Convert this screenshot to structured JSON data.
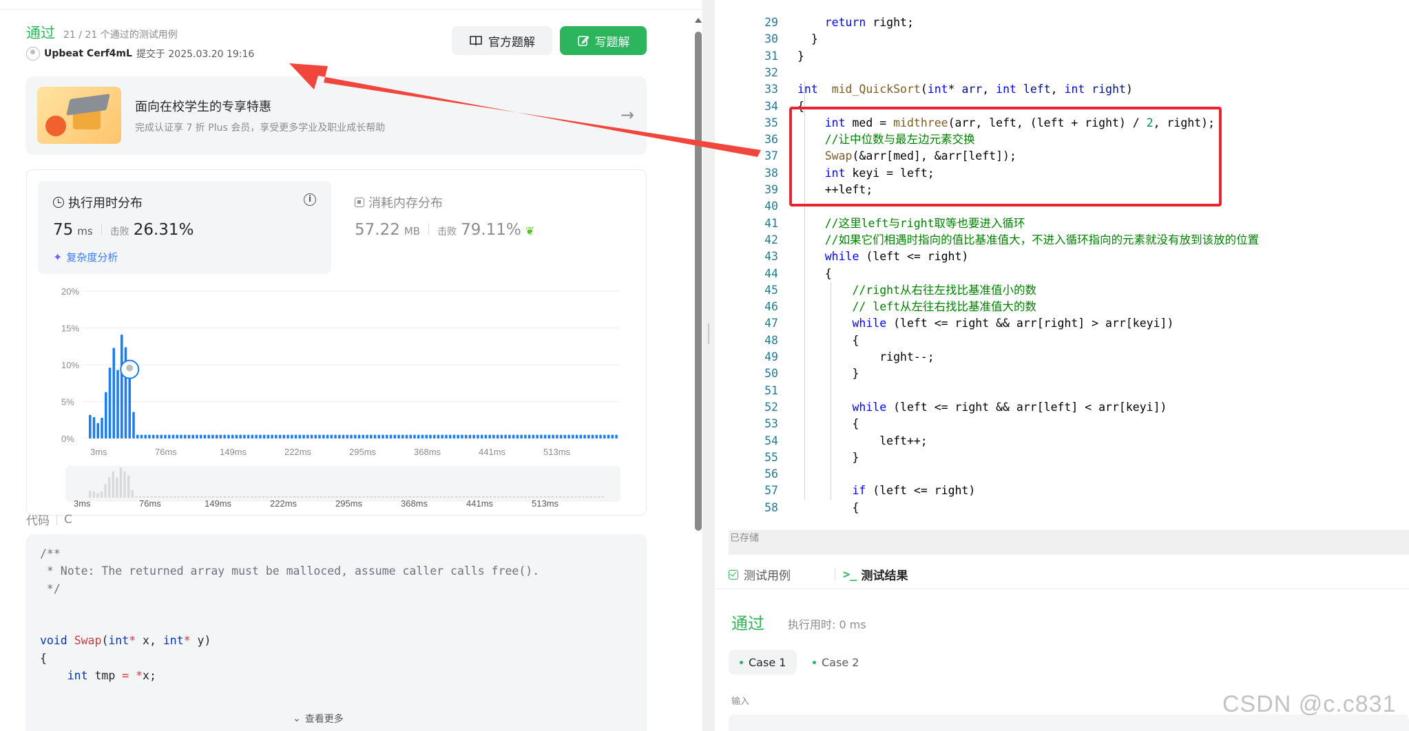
{
  "submission": {
    "status": "通过",
    "testcases": "21 / 21 个通过的测试用例",
    "user": "Upbeat Cerf4mL",
    "submitted_at": "提交于 2025.03.20 19:16"
  },
  "buttons": {
    "official_solution": "官方题解",
    "write_solution": "写题解"
  },
  "promo": {
    "title": "面向在校学生的专享特惠",
    "desc": "完成认证享 7 折 Plus 会员，享受更多学业及职业成长帮助"
  },
  "runtime": {
    "title": "执行用时分布",
    "value": "75",
    "unit": "ms",
    "beat_label": "击败",
    "beat": "26.31%",
    "complexity_link": "复杂度分析"
  },
  "memory": {
    "title": "消耗内存分布",
    "value": "57.22",
    "unit": "MB",
    "beat_label": "击败",
    "beat": "79.11%"
  },
  "chart_data": {
    "type": "bar",
    "ylabel_ticks": [
      "0%",
      "5%",
      "10%",
      "15%",
      "20%"
    ],
    "ylim": [
      0,
      20
    ],
    "x_tick_labels": [
      "3ms",
      "76ms",
      "149ms",
      "222ms",
      "295ms",
      "368ms",
      "441ms",
      "513ms"
    ],
    "x_start": 3,
    "x_step": 4,
    "values": [
      3.2,
      2.9,
      2.1,
      2.8,
      6.3,
      9.6,
      12.3,
      9.3,
      14.1,
      12.4,
      10.5,
      3.6,
      0.5,
      0.5,
      0.5,
      0.5,
      0.5,
      0.5,
      0.5,
      0.5,
      0.5,
      0.5,
      0.5,
      0.5,
      0.5,
      0.5,
      0.5,
      0.5,
      0.5,
      0.5,
      0.5,
      0.5,
      0.5,
      0.5,
      0.5,
      0.5,
      0.5,
      0.5,
      0.5,
      0.5,
      0.5,
      0.5,
      0.5,
      0.5,
      0.5,
      0.5,
      0.5,
      0.5,
      0.5,
      0.5,
      0.5,
      0.5,
      0.5,
      0.5,
      0.5,
      0.5,
      0.5,
      0.5,
      0.5,
      0.5,
      0.5,
      0.5,
      0.5,
      0.5,
      0.5,
      0.5,
      0.5,
      0.5,
      0.5,
      0.5,
      0.5,
      0.5,
      0.5,
      0.5,
      0.5,
      0.5,
      0.5,
      0.5,
      0.5,
      0.5,
      0.5,
      0.5,
      0.5,
      0.5,
      0.5,
      0.5,
      0.5,
      0.5,
      0.5,
      0.5,
      0.5,
      0.5,
      0.5,
      0.5,
      0.5,
      0.5,
      0.5,
      0.5,
      0.5,
      0.5,
      0.5,
      0.5,
      0.5,
      0.5,
      0.5,
      0.5,
      0.5,
      0.5,
      0.5,
      0.5,
      0.5,
      0.5,
      0.5,
      0.5,
      0.5,
      0.5,
      0.5,
      0.5,
      0.5,
      0.5,
      0.5,
      0.5,
      0.5,
      0.5,
      0.5,
      0.5,
      0.5,
      0.5,
      0.5,
      0.5,
      0.5,
      0.5,
      0.5,
      0.5
    ],
    "marker_index": 10,
    "bar_color": "#1a7ef0",
    "grid": true
  },
  "code_section": {
    "label": "代码",
    "lang": "C",
    "view_more": "查看更多"
  },
  "editor": {
    "saved": "已存储",
    "lines": [
      {
        "n": "29",
        "html": "    <span class='e-kw'>return</span> right;"
      },
      {
        "n": "30",
        "html": "  }"
      },
      {
        "n": "31",
        "html": "}"
      },
      {
        "n": "32",
        "html": ""
      },
      {
        "n": "33",
        "html": "<span class='e-kw'>int</span>  <span class='e-fn'>mid_QuickSort</span>(<span class='e-kw'>int</span>* <span class='e-var'>arr</span>, <span class='e-kw'>int</span> <span class='e-var'>left</span>, <span class='e-kw'>int</span> <span class='e-var'>right</span>)"
      },
      {
        "n": "34",
        "html": "{"
      },
      {
        "n": "35",
        "html": "    <span class='e-kw'>int</span> med = <span class='e-fn'>midthree</span>(arr, left, (left + right) / <span class='e-num'>2</span>, right);"
      },
      {
        "n": "36",
        "html": "    <span class='e-com'>//让中位数与最左边元素交换</span>"
      },
      {
        "n": "37",
        "html": "    <span class='e-fn'>Swap</span>(&amp;arr[med], &amp;arr[left]);"
      },
      {
        "n": "38",
        "html": "    <span class='e-kw'>int</span> keyi = left;"
      },
      {
        "n": "39",
        "html": "    ++left;"
      },
      {
        "n": "40",
        "html": ""
      },
      {
        "n": "41",
        "html": "    <span class='e-com'>//这里left与right取等也要进入循环</span>"
      },
      {
        "n": "42",
        "html": "    <span class='e-com'>//如果它们相遇时指向的值比基准值大，不进入循环指向的元素就没有放到该放的位置</span>"
      },
      {
        "n": "43",
        "html": "    <span class='e-kw'>while</span> (left &lt;= right)"
      },
      {
        "n": "44",
        "html": "    {"
      },
      {
        "n": "45",
        "html": "        <span class='e-com'>//right从右往左找比基准值小的数</span>"
      },
      {
        "n": "46",
        "html": "        <span class='e-com'>// left从左往右找比基准值大的数</span>"
      },
      {
        "n": "47",
        "html": "        <span class='e-kw'>while</span> (left &lt;= right &amp;&amp; arr[right] &gt; arr[keyi])"
      },
      {
        "n": "48",
        "html": "        {"
      },
      {
        "n": "49",
        "html": "            right--;"
      },
      {
        "n": "50",
        "html": "        }"
      },
      {
        "n": "51",
        "html": ""
      },
      {
        "n": "52",
        "html": "        <span class='e-kw'>while</span> (left &lt;= right &amp;&amp; arr[left] &lt; arr[keyi])"
      },
      {
        "n": "53",
        "html": "        {"
      },
      {
        "n": "54",
        "html": "            left++;"
      },
      {
        "n": "55",
        "html": "        }"
      },
      {
        "n": "56",
        "html": ""
      },
      {
        "n": "57",
        "html": "        <span class='e-kw'>if</span> (left &lt;= right)"
      },
      {
        "n": "58",
        "html": "        {"
      }
    ]
  },
  "test_panel": {
    "tab_testcase": "测试用例",
    "tab_result": "测试结果",
    "status": "通过",
    "time": "执行用时: 0 ms",
    "case1": "Case 1",
    "case2": "Case 2",
    "input_label": "输入"
  },
  "watermark": "CSDN @c.c831"
}
